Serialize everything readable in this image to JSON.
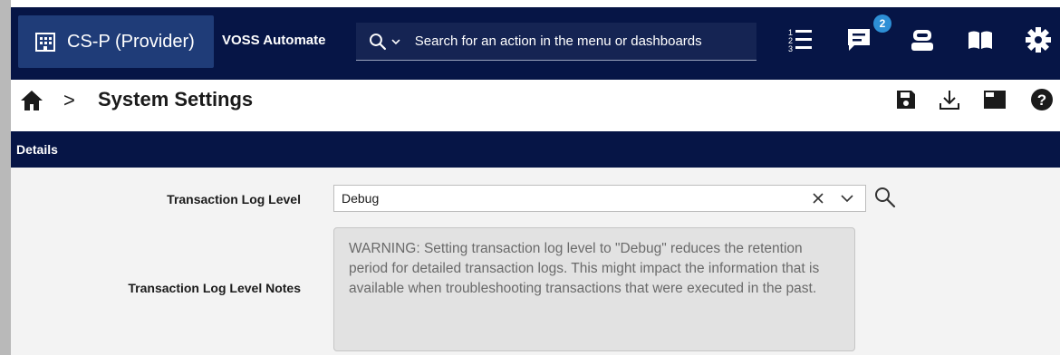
{
  "topbar": {
    "tenant_label": "CS-P (Provider)",
    "product_name": "VOSS Automate",
    "search": {
      "placeholder": "Search for an action in the menu or dashboards",
      "value": ""
    },
    "icons": [
      "building-icon",
      "search-icon",
      "chevron-down-icon",
      "transactions-list-icon",
      "messages-icon",
      "assistant-bot-icon",
      "docs-book-icon",
      "gear-icon"
    ],
    "notifications_count": "2"
  },
  "breadcrumb": {
    "page_title": "System Settings",
    "separator": ">"
  },
  "actions": [
    "save-icon",
    "download-icon",
    "panel-toggle-icon",
    "help-icon"
  ],
  "section": {
    "title": "Details"
  },
  "form": {
    "transaction_log_level": {
      "label": "Transaction Log Level",
      "value": "Debug"
    },
    "transaction_log_level_notes": {
      "label": "Transaction Log Level Notes",
      "text": "WARNING: Setting transaction log level to \"Debug\" reduces the retention period for detailed transaction logs. This might impact the information that is available when troubleshooting transactions that were executed in the past."
    }
  },
  "colors": {
    "nav_bg": "#061546",
    "tenant_bg": "#1f3c78",
    "badge": "#2d8fd6",
    "form_bg": "#f3f3f3"
  }
}
